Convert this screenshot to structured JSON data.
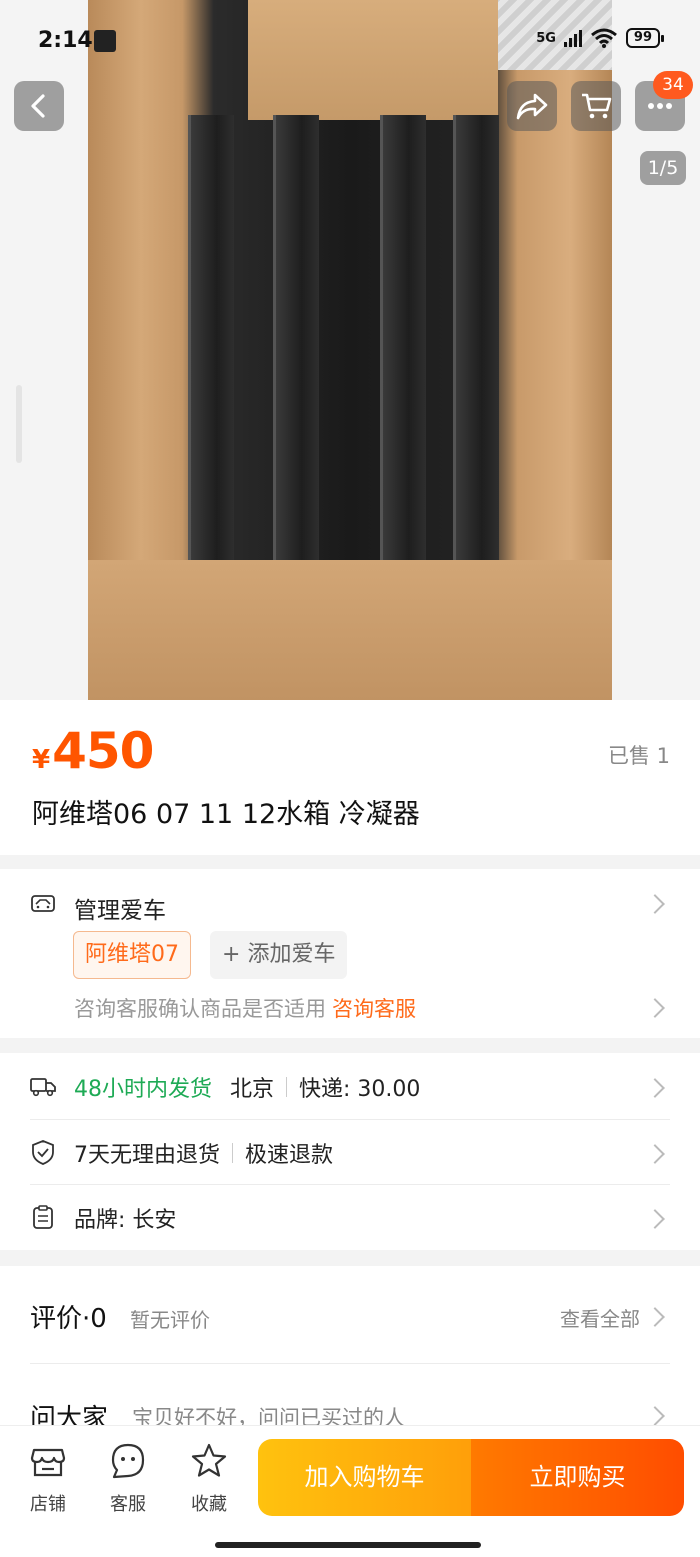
{
  "status_bar": {
    "time": "2:14",
    "network": "5G",
    "battery": "99"
  },
  "header": {
    "cart_badge": "34",
    "image_counter": "1/5"
  },
  "product": {
    "price_symbol": "¥",
    "price": "450",
    "sold": "已售 1",
    "title": "阿维塔06 07 11 12水箱 冷凝器"
  },
  "car": {
    "label": "管理爱车",
    "selected_car": "阿维塔07",
    "add_car": "添加爱车",
    "add_car_icon": "+",
    "consult_text": "咨询客服确认商品是否适用",
    "consult_link": "咨询客服"
  },
  "service": {
    "shipping_time": "48小时内发货",
    "ship_from": "北京",
    "shipping_fee": "快递:  30.00",
    "return_policy": "7天无理由退货",
    "refund": "极速退款",
    "brand": "品牌: 长安"
  },
  "reviews": {
    "title": "评价·0",
    "subtitle": "暂无评价",
    "view_all": "查看全部",
    "ask_title": "问大家",
    "ask_subtitle": "宝贝好不好，问问已买过的人"
  },
  "bottom_bar": {
    "shop": "店铺",
    "service": "客服",
    "favorite": "收藏",
    "add_to_cart": "加入购物车",
    "buy_now": "立即购买"
  },
  "colors": {
    "accent": "#ff5500",
    "green": "#1eaa55",
    "cart_btn": "#ffb20e",
    "buy_btn": "#ff5a00"
  }
}
